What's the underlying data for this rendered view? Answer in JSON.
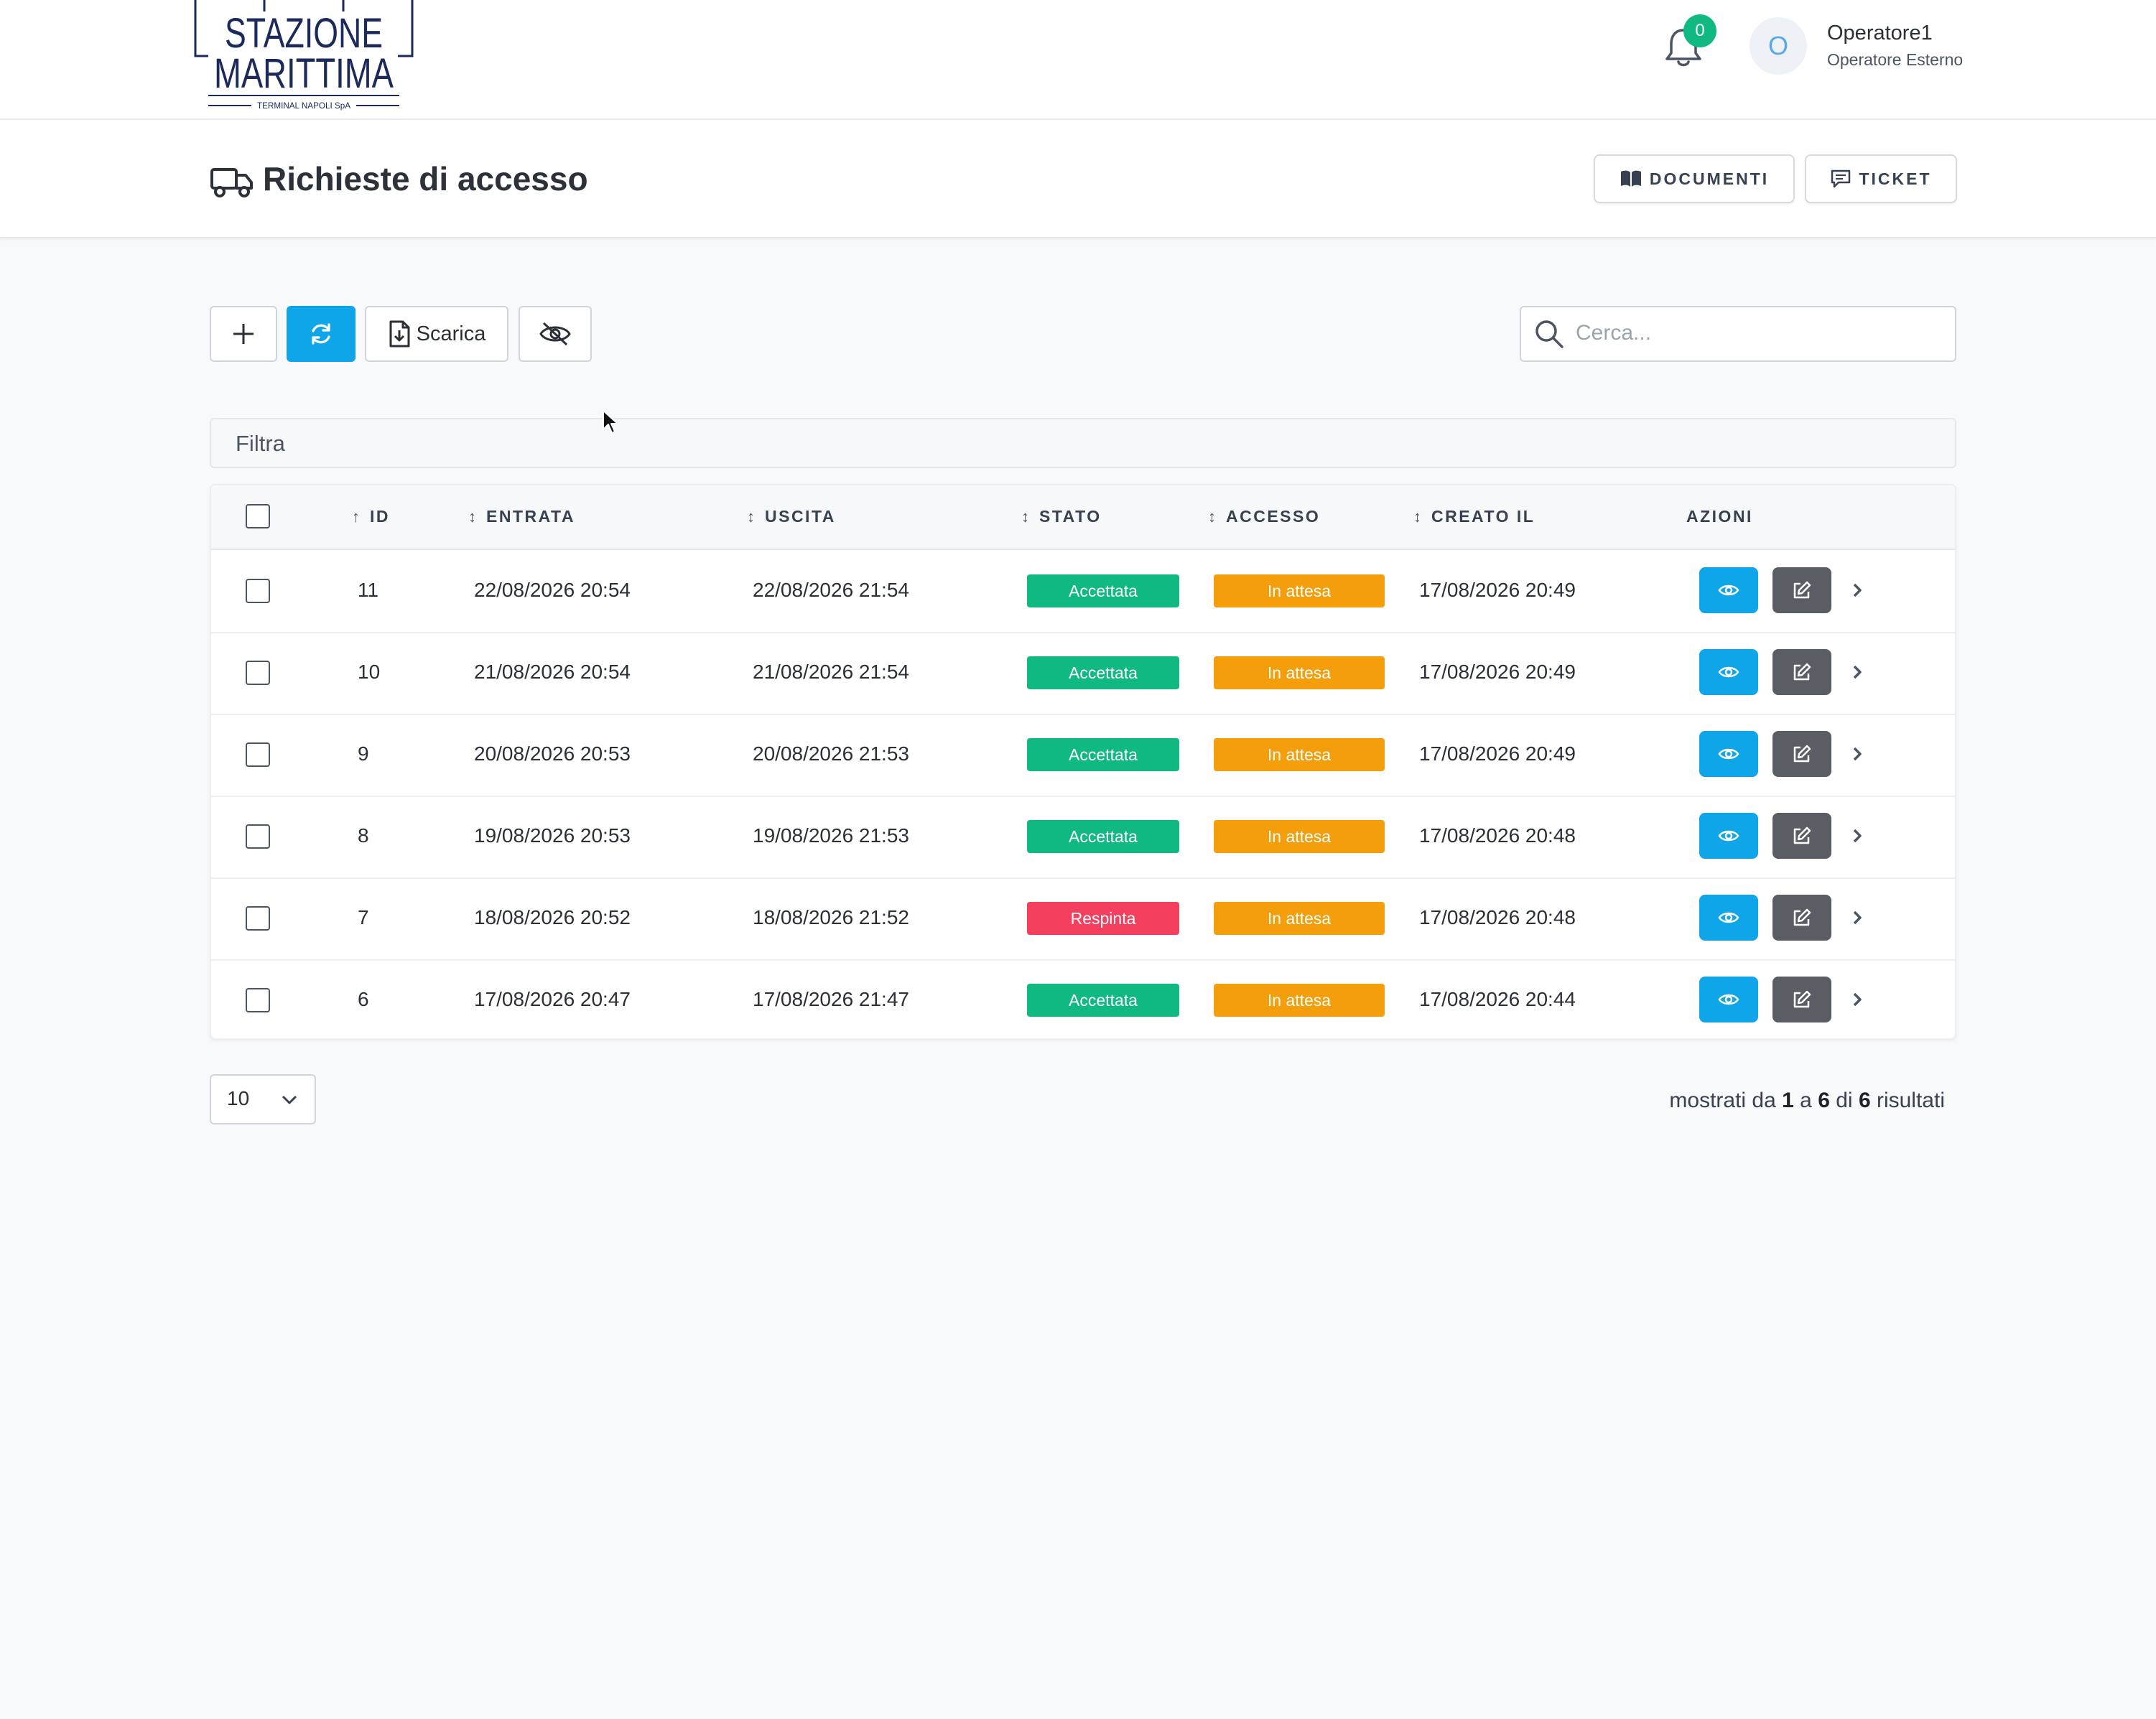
{
  "brand": {
    "line1": "STAZIONE",
    "line2": "MARITTIMA",
    "line3": "TERMINAL NAPOLI SpA"
  },
  "notifications": {
    "count": "0"
  },
  "user": {
    "initial": "O",
    "name": "Operatore1",
    "role": "Operatore Esterno"
  },
  "page": {
    "title": "Richieste di accesso"
  },
  "header_buttons": {
    "documents": "DOCUMENTI",
    "ticket": "TICKET"
  },
  "toolbar": {
    "download": "Scarica"
  },
  "search": {
    "placeholder": "Cerca..."
  },
  "filter": {
    "label": "Filtra"
  },
  "table": {
    "columns": [
      "ID",
      "ENTRATA",
      "USCITA",
      "STATO",
      "ACCESSO",
      "CREATO IL",
      "AZIONI"
    ],
    "sort_active": "↑",
    "sort_idle": "↕",
    "rows": [
      {
        "id": "11",
        "entrata": "22/08/2026 20:54",
        "uscita": "22/08/2026 21:54",
        "stato": "Accettata",
        "accesso": "In attesa",
        "creato": "17/08/2026 20:49"
      },
      {
        "id": "10",
        "entrata": "21/08/2026 20:54",
        "uscita": "21/08/2026 21:54",
        "stato": "Accettata",
        "accesso": "In attesa",
        "creato": "17/08/2026 20:49"
      },
      {
        "id": "9",
        "entrata": "20/08/2026 20:53",
        "uscita": "20/08/2026 21:53",
        "stato": "Accettata",
        "accesso": "In attesa",
        "creato": "17/08/2026 20:49"
      },
      {
        "id": "8",
        "entrata": "19/08/2026 20:53",
        "uscita": "19/08/2026 21:53",
        "stato": "Accettata",
        "accesso": "In attesa",
        "creato": "17/08/2026 20:48"
      },
      {
        "id": "7",
        "entrata": "18/08/2026 20:52",
        "uscita": "18/08/2026 21:52",
        "stato": "Respinta",
        "accesso": "In attesa",
        "creato": "17/08/2026 20:48"
      },
      {
        "id": "6",
        "entrata": "17/08/2026 20:47",
        "uscita": "17/08/2026 21:47",
        "stato": "Accettata",
        "accesso": "In attesa",
        "creato": "17/08/2026 20:44"
      }
    ]
  },
  "pagination": {
    "page_size": "10",
    "t1": "mostrati da",
    "from": "1",
    "t2": "a",
    "to": "6",
    "t3": "di",
    "total": "6",
    "t4": "risultati"
  },
  "colors": {
    "accent": "#0ea5e9",
    "accepted": "#10b981",
    "rejected": "#f43f5e",
    "pending": "#f59e0b",
    "edit": "#5a5d63"
  },
  "icons": [
    "logo",
    "bell-icon",
    "truck-icon",
    "book-icon",
    "chat-icon",
    "plus-icon",
    "refresh-icon",
    "file-download-icon",
    "eye-off-icon",
    "search-icon",
    "eye-icon",
    "edit-icon",
    "chevron-right-icon",
    "chevron-down-icon",
    "cursor-icon"
  ]
}
